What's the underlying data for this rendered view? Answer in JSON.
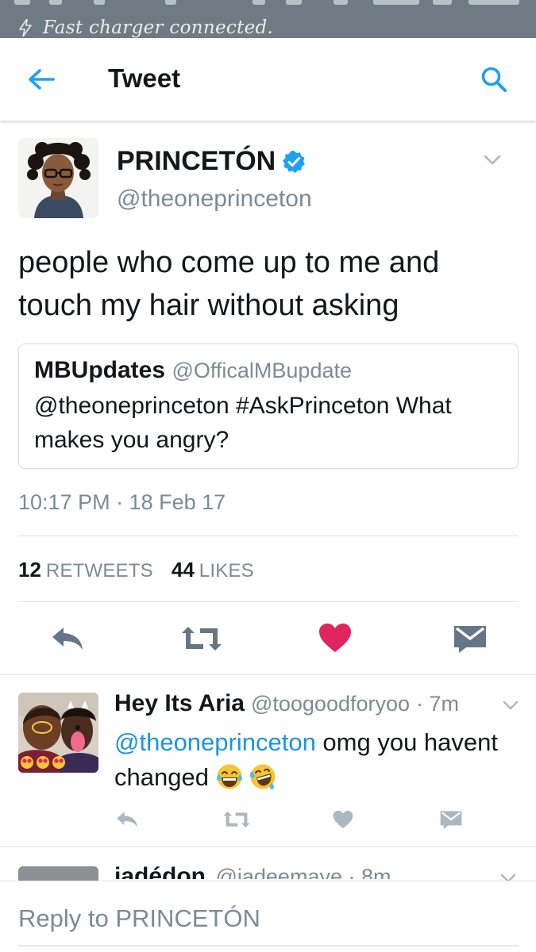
{
  "status_bar": {
    "notification": "Fast charger connected.",
    "background": "#6f7b84"
  },
  "app_bar": {
    "title": "Tweet",
    "back_icon": "back-arrow-icon",
    "search_icon": "search-icon",
    "accent": "#1da1f2"
  },
  "tweet": {
    "author_name": "PRINCETÓN",
    "author_handle": "@theoneprinceton",
    "verified": true,
    "text": "people who come up to me and touch my hair without asking",
    "quote": {
      "name": "MBUpdates",
      "handle": "@OfficalMBupdate",
      "text": "@theoneprinceton #AskPrinceton What makes you angry?"
    },
    "timestamp": "10:17 PM · 18 Feb 17",
    "retweets_count": "12",
    "retweets_label": "RETWEETS",
    "likes_count": "44",
    "likes_label": "LIKES",
    "liked": true,
    "like_color": "#e0245e",
    "actions": [
      "reply-icon",
      "retweet-icon",
      "heart-icon",
      "direct-message-icon"
    ]
  },
  "replies": [
    {
      "name": "Hey Its Aria",
      "handle": "@toogoodforyoo",
      "time": "· 7m",
      "mention": "@theoneprinceton",
      "text": " omg you havent changed",
      "emojis": [
        "laughing-tears-emoji",
        "crying-laughing-emoji"
      ]
    }
  ],
  "next_reply": {
    "name": "jadédon",
    "meta": "@jadeemaye · 8m"
  },
  "composer": {
    "placeholder": "Reply to PRINCETÓN"
  }
}
